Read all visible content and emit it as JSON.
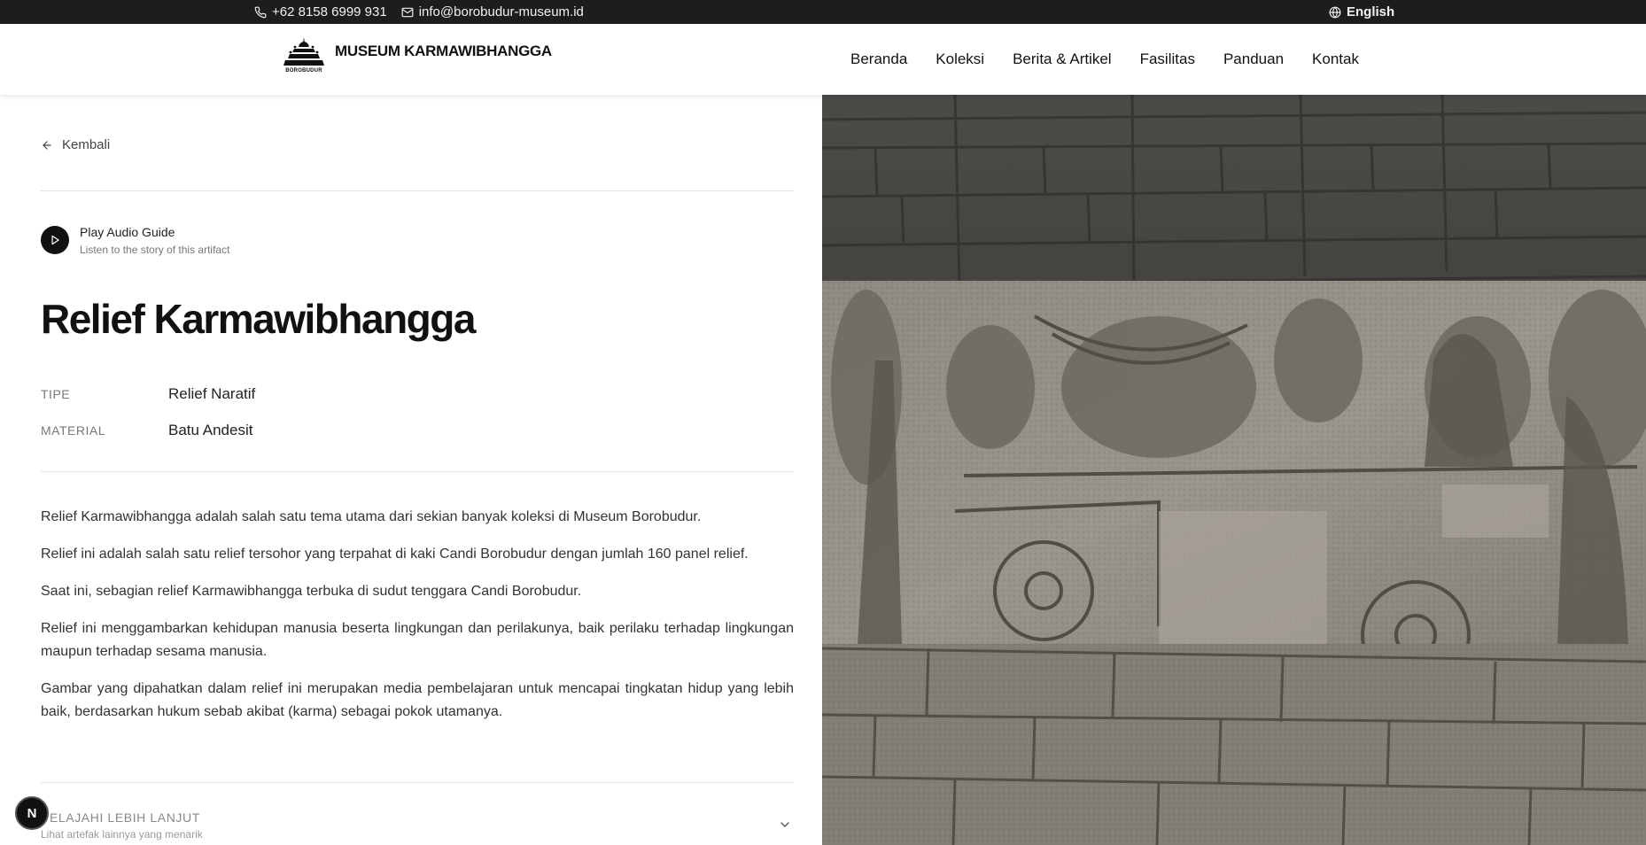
{
  "topbar": {
    "phone": "+62 8158 6999 931",
    "email": "info@borobudur-museum.id",
    "language": "English"
  },
  "header": {
    "logo_text": "BOROBUDUR",
    "brand_name": "MUSEUM KARMAWIBHANGGA",
    "nav": [
      "Beranda",
      "Koleksi",
      "Berita & Artikel",
      "Fasilitas",
      "Panduan",
      "Kontak"
    ]
  },
  "main": {
    "back_label": "Kembali",
    "audio": {
      "title": "Play Audio Guide",
      "subtitle": "Listen to the story of this artifact"
    },
    "title": "Relief Karmawibhangga",
    "meta": [
      {
        "key": "TIPE",
        "value": "Relief Naratif"
      },
      {
        "key": "MATERIAL",
        "value": "Batu Andesit"
      }
    ],
    "description": [
      "Relief Karmawibhangga adalah salah satu tema utama dari sekian banyak koleksi di Museum Borobudur.",
      "Relief ini adalah salah satu relief tersohor yang terpahat di kaki Candi Borobudur dengan jumlah 160 panel relief.",
      "Saat ini, sebagian relief Karmawibhangga terbuka di sudut tenggara Candi Borobudur.",
      "Relief ini menggambarkan kehidupan manusia beserta lingkungan dan perilakunya, baik perilaku terhadap lingkungan maupun terhadap sesama manusia.",
      "Gambar yang dipahatkan dalam relief ini merupakan media pembelajaran untuk mencapai tingkatan hidup yang lebih baik, berdasarkan hukum sebab akibat (karma) sebagai pokok utamanya."
    ],
    "explore": {
      "title": "PELAJAHI LEBIH LANJUT",
      "subtitle": "Lihat artefak lainnya yang menarik"
    }
  },
  "dev_badge": "N",
  "colors": {
    "topbar_bg": "#1d1d1d",
    "text_dark": "#111111",
    "stone": "#8a8780"
  }
}
